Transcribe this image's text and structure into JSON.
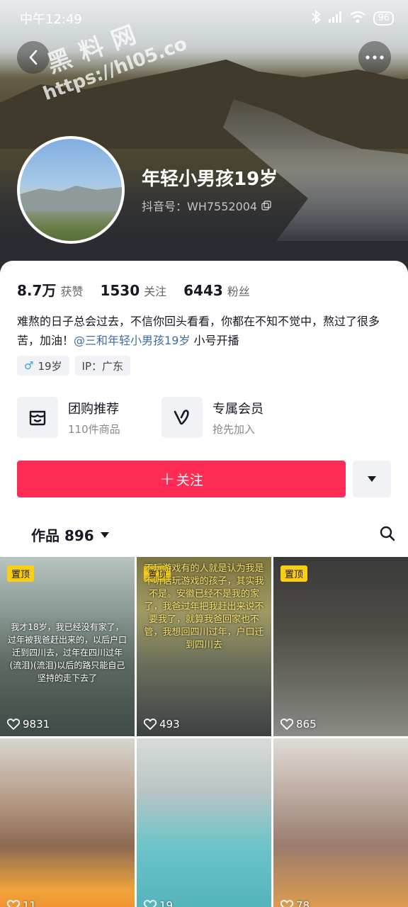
{
  "status_bar": {
    "time": "中午12:49",
    "battery": "96"
  },
  "watermark": {
    "line1": "黑料网",
    "line2": "https://hl05.co"
  },
  "profile": {
    "nickname": "年轻小男孩19岁",
    "douyin_id": "抖音号：WH7552004",
    "stats": [
      {
        "num": "8.7万",
        "label": "获赞"
      },
      {
        "num": "1530",
        "label": "关注"
      },
      {
        "num": "6443",
        "label": "粉丝"
      }
    ],
    "bio_text": "难熬的日子总会过去，不信你回头看看，你都在不知不觉中，熬过了很多苦，加油！",
    "bio_mention": "@三和年轻小男孩19岁",
    "bio_suffix": " 小号开播",
    "tags": {
      "age": "19岁",
      "ip": "IP：广东"
    }
  },
  "services": [
    {
      "title": "团购推荐",
      "sub": "110件商品"
    },
    {
      "title": "专属会员",
      "sub": "抢先加入"
    }
  ],
  "actions": {
    "follow_label": "关注",
    "follow_plus": "+"
  },
  "works": {
    "label": "作品 896",
    "items": [
      {
        "pinned": "置顶",
        "likes": "9831",
        "caption": "我才18岁，我已经没有家了，过年被我爸赶出来的，以后户口迁到四川去，过年在四川过年(流泪)(流泪)以后的路只能自己坚持的走下去了"
      },
      {
        "pinned": "置顶",
        "likes": "493",
        "caption": "不玩游戏有的人就是认为我是不听话玩游戏的孩子，其实我不是。安徽已经不是我的家了，我爸过年把我赶出来说不要我了，就算我爸回家也不管，我想回四川过年，户口迁到四川去"
      },
      {
        "pinned": "置顶",
        "likes": "865",
        "caption": ""
      },
      {
        "pinned": "",
        "likes": "11",
        "caption": ""
      },
      {
        "pinned": "",
        "likes": "19",
        "caption": ""
      },
      {
        "pinned": "",
        "likes": "78",
        "caption": ""
      }
    ]
  },
  "colors": {
    "accent": "#fe2c55",
    "pin": "#face15",
    "mention": "#3e6ea5"
  }
}
